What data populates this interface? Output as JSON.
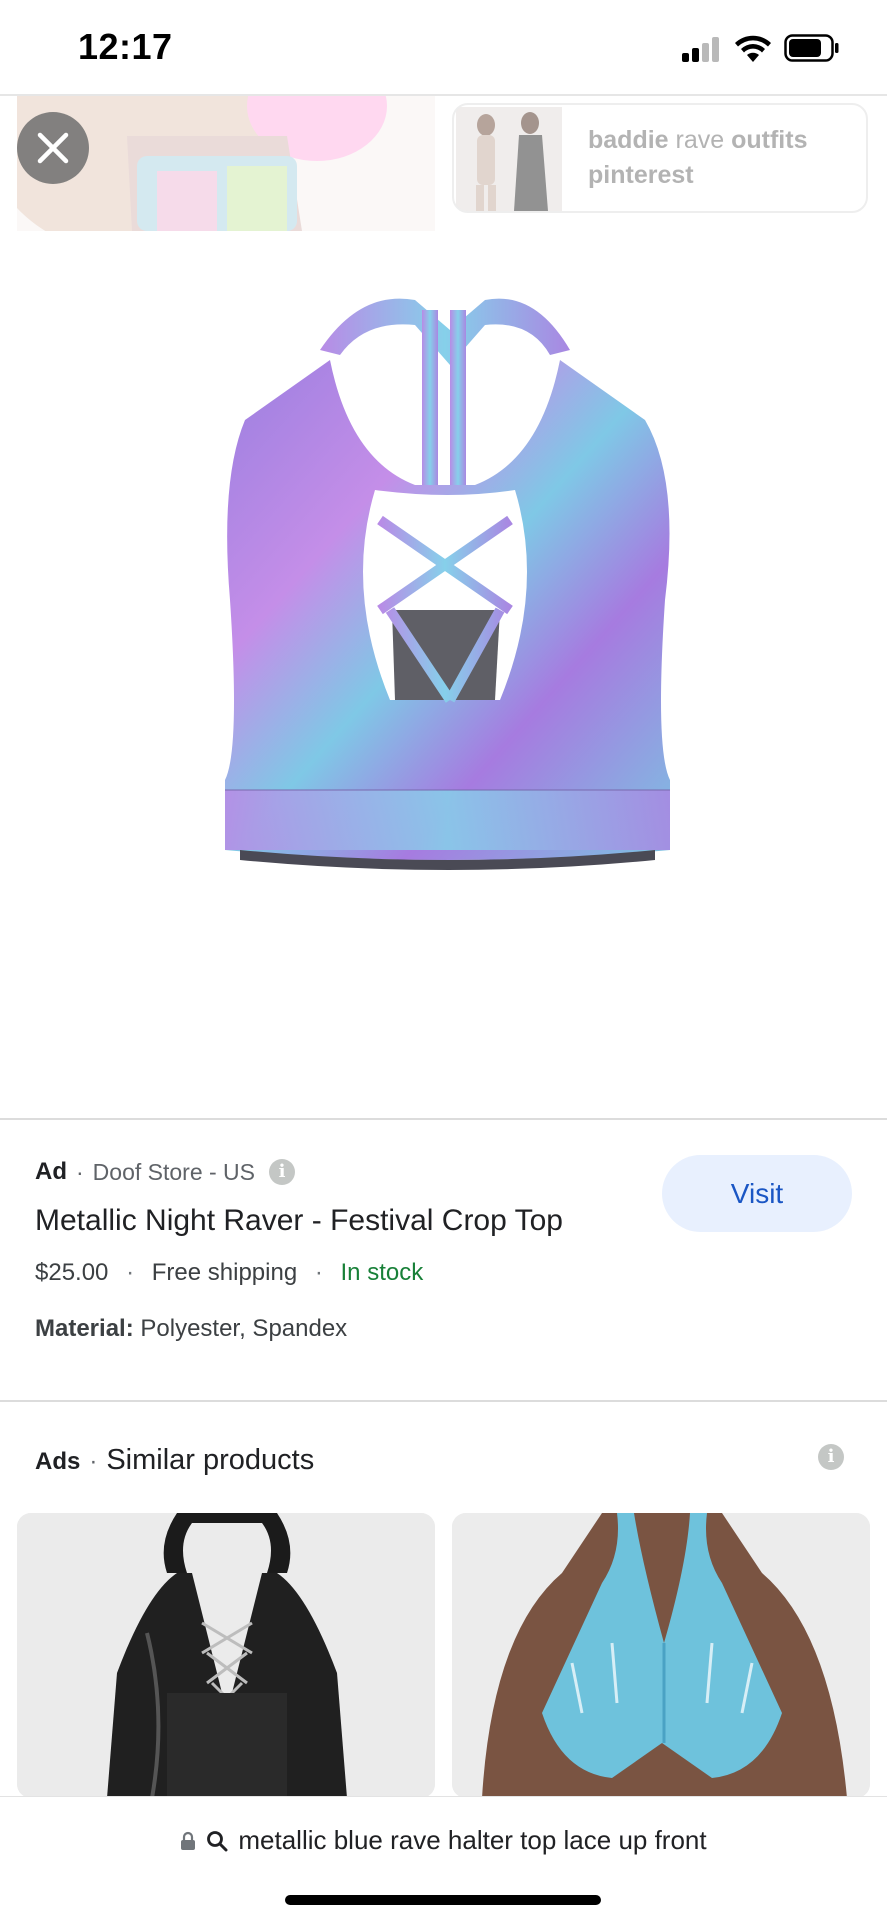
{
  "status_bar": {
    "time": "12:17"
  },
  "top_strip": {
    "related_search": {
      "bold_1": "baddie",
      "light_1": " rave ",
      "bold_2": "outfits",
      "line2": "pinterest"
    }
  },
  "ad": {
    "label": "Ad",
    "store": "Doof Store - US",
    "visit_label": "Visit",
    "title": "Metallic Night Raver - Festival Crop Top",
    "price": "$25.00",
    "shipping": "Free shipping",
    "stock": "In stock",
    "material_label": "Material:",
    "material_value": "Polyester, Spandex"
  },
  "similar": {
    "ads_label": "Ads",
    "title": "Similar products"
  },
  "bottom_bar": {
    "query": "metallic blue rave halter top lace up front"
  },
  "colors": {
    "visit_bg": "#e8f0fe",
    "visit_text": "#1a56c4",
    "in_stock": "#188038",
    "divider": "#dcdcdc"
  },
  "icons": [
    "close-icon",
    "info-icon",
    "lock-icon",
    "search-icon",
    "signal-icon",
    "wifi-icon",
    "battery-icon"
  ],
  "separator": "·"
}
